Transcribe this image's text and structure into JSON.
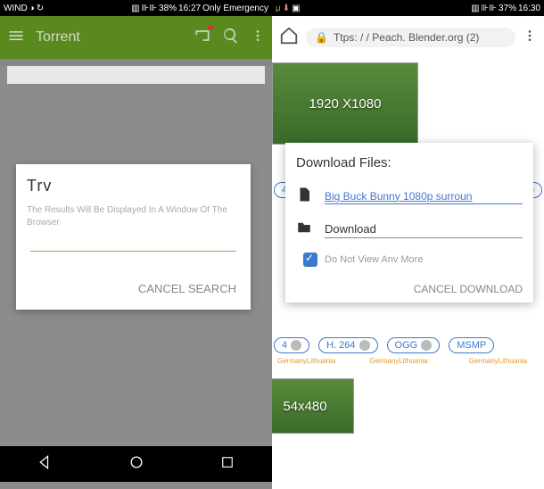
{
  "left": {
    "statusbar": {
      "carrier": "WIND",
      "batt": "38%",
      "time": "16:27",
      "network": "Only Emergency"
    },
    "appbar": {
      "title": "Torrent"
    },
    "dialog": {
      "title": "Trv",
      "body": "The Results Will Be Displayed In A Window Of The Browser",
      "cancel_search": "CANCEL",
      "search": "SEARCH"
    }
  },
  "right": {
    "statusbar": {
      "batt": "37%",
      "time": "16:30"
    },
    "url": "Ttps: / / Peach. Blender.org (2)",
    "thumb_main": "1920 X1080",
    "thumb_small": "54x480",
    "dialog": {
      "title": "Download Files:",
      "file_name": "Big Buck Bunny 1080p surroun",
      "folder": "Download",
      "checkbox_label": "Do Not View Anv More",
      "cancel": "CANCEL",
      "download": "DOWNLOAD"
    },
    "pills": {
      "p1": "4",
      "p2": "H. 264",
      "p3": "OGG",
      "p4": "MSMP"
    },
    "caption1": "GermanyLithuania",
    "caption2": "GermanyLithuania",
    "caption3": "GermanyLithuania"
  }
}
